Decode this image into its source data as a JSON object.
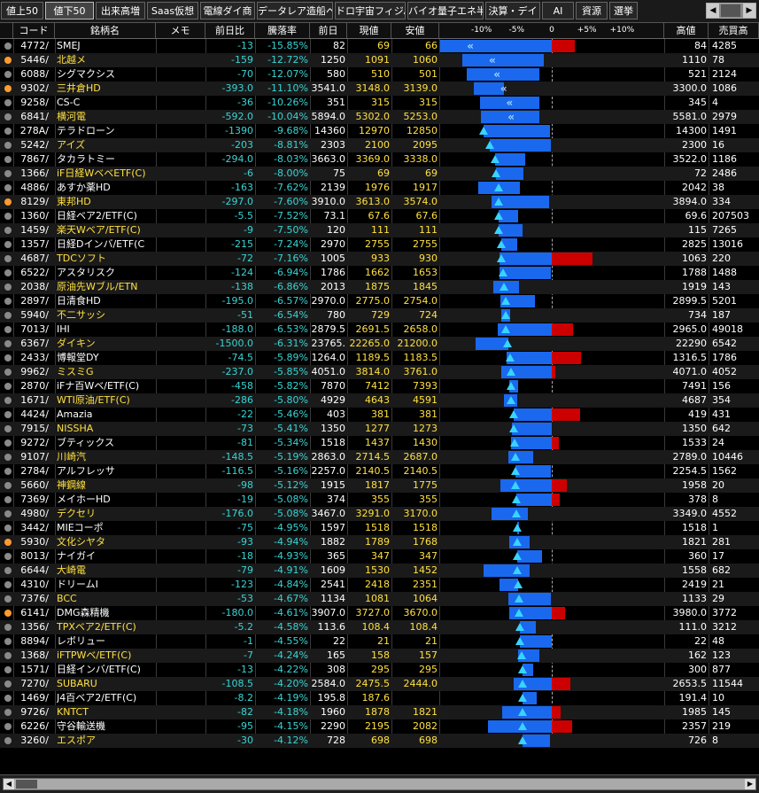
{
  "tabs": [
    {
      "label": "値上50",
      "active": false
    },
    {
      "label": "値下50",
      "active": true
    },
    {
      "label": "出来高増",
      "active": false
    },
    {
      "label": "Saas仮想",
      "active": false
    },
    {
      "label": "電線ダイ商",
      "active": false
    },
    {
      "label": "データレア造船ペロ銀行",
      "active": false
    },
    {
      "label": "ドロ宇宙フィジAI",
      "active": false
    },
    {
      "label": "バイオ量子エネ半導",
      "active": false
    },
    {
      "label": "決算・デイ",
      "active": false
    },
    {
      "label": "AI",
      "active": false
    },
    {
      "label": "資源",
      "active": false
    },
    {
      "label": "選挙",
      "active": false
    }
  ],
  "columns": {
    "code": "コード",
    "name": "銘柄名",
    "memo": "メモ",
    "change": "前日比",
    "drop_rate": "騰落率",
    "prev": "前日",
    "current": "現値",
    "low": "安値",
    "high": "高値",
    "volume": "売買高"
  },
  "axis": {
    "labels": [
      "-10%",
      "-5%",
      "0",
      "+5%",
      "+10%"
    ],
    "ticks": [
      -10,
      -5,
      0,
      5,
      10
    ],
    "range": [
      -16,
      16
    ]
  },
  "colors": {
    "change_neg": "#38d4d4",
    "price": "#ffe040",
    "bar_neg": "#1a68ee",
    "bar_pos": "#cc0000",
    "marker": "#38d4ff"
  },
  "rows": [
    {
      "dot": "grey",
      "code": "4772/",
      "name": "SMEJ",
      "yellow": false,
      "memo": "",
      "change": "-13",
      "pct": "-15.85%",
      "prev": "82",
      "now": "69",
      "low": "66",
      "high": "84",
      "vol": "4285",
      "bar_from": -15.85,
      "bar_to": 3.3,
      "marker": -15.85
    },
    {
      "dot": "orange",
      "code": "5446/",
      "name": "北越メ",
      "yellow": true,
      "memo": "",
      "change": "-159",
      "pct": "-12.72%",
      "prev": "1250",
      "now": "1091",
      "low": "1060",
      "high": "1110",
      "vol": "78",
      "bar_from": -12.72,
      "bar_to": -1.1,
      "marker": -12.72
    },
    {
      "dot": "grey",
      "code": "6088/",
      "name": "シグマクシス",
      "yellow": false,
      "memo": "",
      "change": "-70",
      "pct": "-12.07%",
      "prev": "580",
      "now": "510",
      "low": "501",
      "high": "521",
      "vol": "2124",
      "bar_from": -12.07,
      "bar_to": -1.7,
      "marker": -12.07
    },
    {
      "dot": "orange",
      "code": "9302/",
      "name": "三井倉HD",
      "yellow": true,
      "memo": "",
      "change": "-393.0",
      "pct": "-11.10%",
      "prev": "3541.0",
      "now": "3148.0",
      "low": "3139.0",
      "high": "3300.0",
      "vol": "1086",
      "bar_from": -11.1,
      "bar_to": -6.8,
      "marker": -11.1
    },
    {
      "dot": "grey",
      "code": "9258/",
      "name": "CS-C",
      "yellow": false,
      "memo": "",
      "change": "-36",
      "pct": "-10.26%",
      "prev": "351",
      "now": "315",
      "low": "315",
      "high": "345",
      "vol": "4",
      "bar_from": -10.26,
      "bar_to": -1.7,
      "marker": -10.26
    },
    {
      "dot": "grey",
      "code": "6841/",
      "name": "横河電",
      "yellow": true,
      "memo": "",
      "change": "-592.0",
      "pct": "-10.04%",
      "prev": "5894.0",
      "now": "5302.0",
      "low": "5253.0",
      "high": "5581.0",
      "vol": "2979",
      "bar_from": -10.04,
      "bar_to": -1.7,
      "marker": -10.04
    },
    {
      "dot": "grey",
      "code": "278A/",
      "name": "テラドローン",
      "yellow": false,
      "memo": "",
      "change": "-1390",
      "pct": "-9.68%",
      "prev": "14360",
      "now": "12970",
      "low": "12850",
      "high": "14300",
      "vol": "1491",
      "bar_from": -9.68,
      "bar_to": -0.3,
      "marker": -9.68
    },
    {
      "dot": "grey",
      "code": "5242/",
      "name": "アイズ",
      "yellow": true,
      "memo": "",
      "change": "-203",
      "pct": "-8.81%",
      "prev": "2303",
      "now": "2100",
      "low": "2095",
      "high": "2300",
      "vol": "16",
      "bar_from": -8.81,
      "bar_to": -0.1,
      "marker": -8.81
    },
    {
      "dot": "grey",
      "code": "7867/",
      "name": "タカラトミー",
      "yellow": false,
      "memo": "",
      "change": "-294.0",
      "pct": "-8.03%",
      "prev": "3663.0",
      "now": "3369.0",
      "low": "3338.0",
      "high": "3522.0",
      "vol": "1186",
      "bar_from": -8.03,
      "bar_to": -3.8,
      "marker": -8.03
    },
    {
      "dot": "grey",
      "code": "1366/",
      "name": "iF日経WベベETF(C)",
      "yellow": true,
      "memo": "",
      "change": "-6",
      "pct": "-8.00%",
      "prev": "75",
      "now": "69",
      "low": "69",
      "high": "72",
      "vol": "2486",
      "bar_from": -8.0,
      "bar_to": -4.0,
      "marker": -8.0
    },
    {
      "dot": "grey",
      "code": "4886/",
      "name": "あすか薬HD",
      "yellow": false,
      "memo": "",
      "change": "-163",
      "pct": "-7.62%",
      "prev": "2139",
      "now": "1976",
      "low": "1917",
      "high": "2042",
      "vol": "38",
      "bar_from": -10.4,
      "bar_to": -4.5,
      "marker": -7.62
    },
    {
      "dot": "orange",
      "code": "8129/",
      "name": "東邦HD",
      "yellow": true,
      "memo": "",
      "change": "-297.0",
      "pct": "-7.60%",
      "prev": "3910.0",
      "now": "3613.0",
      "low": "3574.0",
      "high": "3894.0",
      "vol": "334",
      "bar_from": -8.6,
      "bar_to": -0.4,
      "marker": -7.6
    },
    {
      "dot": "grey",
      "code": "1360/",
      "name": "日経ベア2/ETF(C)",
      "yellow": false,
      "memo": "",
      "change": "-5.5",
      "pct": "-7.52%",
      "prev": "73.1",
      "now": "67.6",
      "low": "67.6",
      "high": "69.6",
      "vol": "207503",
      "bar_from": -7.52,
      "bar_to": -4.8,
      "marker": -7.52
    },
    {
      "dot": "grey",
      "code": "1459/",
      "name": "楽天Wベア/ETF(C)",
      "yellow": true,
      "memo": "",
      "change": "-9",
      "pct": "-7.50%",
      "prev": "120",
      "now": "111",
      "low": "111",
      "high": "115",
      "vol": "7265",
      "bar_from": -7.5,
      "bar_to": -4.2,
      "marker": -7.5
    },
    {
      "dot": "grey",
      "code": "1357/",
      "name": "日経Dインバ/ETF(C",
      "yellow": false,
      "memo": "",
      "change": "-215",
      "pct": "-7.24%",
      "prev": "2970",
      "now": "2755",
      "low": "2755",
      "high": "2825",
      "vol": "13016",
      "bar_from": -7.24,
      "bar_to": -4.9,
      "marker": -7.24
    },
    {
      "dot": "grey",
      "code": "4687/",
      "name": "TDCソフト",
      "yellow": true,
      "memo": "",
      "change": "-72",
      "pct": "-7.16%",
      "prev": "1005",
      "now": "933",
      "low": "930",
      "high": "1063",
      "vol": "220",
      "bar_from": -7.46,
      "bar_to": 5.8,
      "marker": -7.16
    },
    {
      "dot": "grey",
      "code": "6522/",
      "name": "アスタリスク",
      "yellow": false,
      "memo": "",
      "change": "-124",
      "pct": "-6.94%",
      "prev": "1786",
      "now": "1662",
      "low": "1653",
      "high": "1788",
      "vol": "1488",
      "bar_from": -7.45,
      "bar_to": -0.1,
      "marker": -6.94
    },
    {
      "dot": "grey",
      "code": "2038/",
      "name": "原油先Wブル/ETN",
      "yellow": true,
      "memo": "",
      "change": "-138",
      "pct": "-6.86%",
      "prev": "2013",
      "now": "1875",
      "low": "1845",
      "high": "1919",
      "vol": "143",
      "bar_from": -8.3,
      "bar_to": -4.6,
      "marker": -6.86
    },
    {
      "dot": "grey",
      "code": "2897/",
      "name": "日清食HD",
      "yellow": false,
      "memo": "",
      "change": "-195.0",
      "pct": "-6.57%",
      "prev": "2970.0",
      "now": "2775.0",
      "low": "2754.0",
      "high": "2899.5",
      "vol": "5201",
      "bar_from": -7.27,
      "bar_to": -2.4,
      "marker": -6.57
    },
    {
      "dot": "grey",
      "code": "5940/",
      "name": "不二サッシ",
      "yellow": true,
      "memo": "",
      "change": "-51",
      "pct": "-6.54%",
      "prev": "780",
      "now": "729",
      "low": "724",
      "high": "734",
      "vol": "187",
      "bar_from": -7.18,
      "bar_to": -5.9,
      "marker": -6.54
    },
    {
      "dot": "grey",
      "code": "7013/",
      "name": "IHI",
      "yellow": false,
      "memo": "",
      "change": "-188.0",
      "pct": "-6.53%",
      "prev": "2879.5",
      "now": "2691.5",
      "low": "2658.0",
      "high": "2965.0",
      "vol": "49018",
      "bar_from": -7.7,
      "bar_to": 3.0,
      "marker": -6.53
    },
    {
      "dot": "grey",
      "code": "6367/",
      "name": "ダイキン",
      "yellow": true,
      "memo": "",
      "change": "-1500.0",
      "pct": "-6.31%",
      "prev": "23765.",
      "now": "22265.0",
      "low": "21200.0",
      "high": "22290",
      "vol": "6542",
      "bar_from": -10.8,
      "bar_to": -6.2,
      "marker": -6.31
    },
    {
      "dot": "grey",
      "code": "2433/",
      "name": "博報堂DY",
      "yellow": false,
      "memo": "",
      "change": "-74.5",
      "pct": "-5.89%",
      "prev": "1264.0",
      "now": "1189.5",
      "low": "1183.5",
      "high": "1316.5",
      "vol": "1786",
      "bar_from": -6.4,
      "bar_to": 4.2,
      "marker": -5.89
    },
    {
      "dot": "grey",
      "code": "9962/",
      "name": "ミスミG",
      "yellow": true,
      "memo": "",
      "change": "-237.0",
      "pct": "-5.85%",
      "prev": "4051.0",
      "now": "3814.0",
      "low": "3761.0",
      "high": "4071.0",
      "vol": "4052",
      "bar_from": -7.2,
      "bar_to": 0.5,
      "marker": -5.85
    },
    {
      "dot": "grey",
      "code": "2870/",
      "name": "iFナ百Wベ/ETF(C)",
      "yellow": false,
      "memo": "",
      "change": "-458",
      "pct": "-5.82%",
      "prev": "7870",
      "now": "7412",
      "low": "7393",
      "high": "7491",
      "vol": "156",
      "bar_from": -6.06,
      "bar_to": -4.8,
      "marker": -5.82
    },
    {
      "dot": "grey",
      "code": "1671/",
      "name": "WTI原油/ETF(C)",
      "yellow": true,
      "memo": "",
      "change": "-286",
      "pct": "-5.80%",
      "prev": "4929",
      "now": "4643",
      "low": "4591",
      "high": "4687",
      "vol": "354",
      "bar_from": -6.86,
      "bar_to": -4.9,
      "marker": -5.8
    },
    {
      "dot": "grey",
      "code": "4424/",
      "name": "Amazia",
      "yellow": false,
      "memo": "",
      "change": "-22",
      "pct": "-5.46%",
      "prev": "403",
      "now": "381",
      "low": "381",
      "high": "419",
      "vol": "431",
      "bar_from": -5.46,
      "bar_to": 4.0,
      "marker": -5.46
    },
    {
      "dot": "grey",
      "code": "7915/",
      "name": "NISSHA",
      "yellow": true,
      "memo": "",
      "change": "-73",
      "pct": "-5.41%",
      "prev": "1350",
      "now": "1277",
      "low": "1273",
      "high": "1350",
      "vol": "642",
      "bar_from": -5.7,
      "bar_to": 0.0,
      "marker": -5.41
    },
    {
      "dot": "grey",
      "code": "9272/",
      "name": "ブティックス",
      "yellow": false,
      "memo": "",
      "change": "-81",
      "pct": "-5.34%",
      "prev": "1518",
      "now": "1437",
      "low": "1430",
      "high": "1533",
      "vol": "24",
      "bar_from": -5.8,
      "bar_to": 1.0,
      "marker": -5.34
    },
    {
      "dot": "grey",
      "code": "9107/",
      "name": "川崎汽",
      "yellow": true,
      "memo": "",
      "change": "-148.5",
      "pct": "-5.19%",
      "prev": "2863.0",
      "now": "2714.5",
      "low": "2687.0",
      "high": "2789.0",
      "vol": "10446",
      "bar_from": -6.15,
      "bar_to": -2.6,
      "marker": -5.19
    },
    {
      "dot": "grey",
      "code": "2784/",
      "name": "アルフレッサ",
      "yellow": false,
      "memo": "",
      "change": "-116.5",
      "pct": "-5.16%",
      "prev": "2257.0",
      "now": "2140.5",
      "low": "2140.5",
      "high": "2254.5",
      "vol": "1562",
      "bar_from": -5.16,
      "bar_to": -0.1,
      "marker": -5.16
    },
    {
      "dot": "grey",
      "code": "5660/",
      "name": "神鋼線",
      "yellow": true,
      "memo": "",
      "change": "-98",
      "pct": "-5.12%",
      "prev": "1915",
      "now": "1817",
      "low": "1775",
      "high": "1958",
      "vol": "20",
      "bar_from": -7.3,
      "bar_to": 2.2,
      "marker": -5.12
    },
    {
      "dot": "grey",
      "code": "7369/",
      "name": "メイホーHD",
      "yellow": false,
      "memo": "",
      "change": "-19",
      "pct": "-5.08%",
      "prev": "374",
      "now": "355",
      "low": "355",
      "high": "378",
      "vol": "8",
      "bar_from": -5.08,
      "bar_to": 1.1,
      "marker": -5.08
    },
    {
      "dot": "grey",
      "code": "4980/",
      "name": "デクセリ",
      "yellow": true,
      "memo": "",
      "change": "-176.0",
      "pct": "-5.08%",
      "prev": "3467.0",
      "now": "3291.0",
      "low": "3170.0",
      "high": "3349.0",
      "vol": "4552",
      "bar_from": -8.6,
      "bar_to": -3.4,
      "marker": -5.08
    },
    {
      "dot": "grey",
      "code": "3442/",
      "name": "MIEコーポ",
      "yellow": false,
      "memo": "",
      "change": "-75",
      "pct": "-4.95%",
      "prev": "1597",
      "now": "1518",
      "low": "1518",
      "high": "1518",
      "vol": "1",
      "bar_from": -4.95,
      "bar_to": -4.95,
      "marker": -4.95
    },
    {
      "dot": "orange",
      "code": "5930/",
      "name": "文化シヤタ",
      "yellow": true,
      "memo": "",
      "change": "-93",
      "pct": "-4.94%",
      "prev": "1882",
      "now": "1789",
      "low": "1768",
      "high": "1821",
      "vol": "281",
      "bar_from": -6.05,
      "bar_to": -3.2,
      "marker": -4.94
    },
    {
      "dot": "grey",
      "code": "8013/",
      "name": "ナイガイ",
      "yellow": false,
      "memo": "",
      "change": "-18",
      "pct": "-4.93%",
      "prev": "365",
      "now": "347",
      "low": "347",
      "high": "360",
      "vol": "17",
      "bar_from": -4.93,
      "bar_to": -1.4,
      "marker": -4.93
    },
    {
      "dot": "grey",
      "code": "6644/",
      "name": "大崎電",
      "yellow": true,
      "memo": "",
      "change": "-79",
      "pct": "-4.91%",
      "prev": "1609",
      "now": "1530",
      "low": "1452",
      "high": "1558",
      "vol": "682",
      "bar_from": -9.76,
      "bar_to": -3.2,
      "marker": -4.91
    },
    {
      "dot": "grey",
      "code": "4310/",
      "name": "ドリームI",
      "yellow": false,
      "memo": "",
      "change": "-123",
      "pct": "-4.84%",
      "prev": "2541",
      "now": "2418",
      "low": "2351",
      "high": "2419",
      "vol": "21",
      "bar_from": -7.48,
      "bar_to": -4.8,
      "marker": -4.84
    },
    {
      "dot": "grey",
      "code": "7376/",
      "name": "BCC",
      "yellow": true,
      "memo": "",
      "change": "-53",
      "pct": "-4.67%",
      "prev": "1134",
      "now": "1081",
      "low": "1064",
      "high": "1133",
      "vol": "29",
      "bar_from": -6.17,
      "bar_to": -0.1,
      "marker": -4.67
    },
    {
      "dot": "orange",
      "code": "6141/",
      "name": "DMG森精機",
      "yellow": false,
      "memo": "",
      "change": "-180.0",
      "pct": "-4.61%",
      "prev": "3907.0",
      "now": "3727.0",
      "low": "3670.0",
      "high": "3980.0",
      "vol": "3772",
      "bar_from": -6.07,
      "bar_to": 1.9,
      "marker": -4.61
    },
    {
      "dot": "grey",
      "code": "1356/",
      "name": "TPXベア2/ETF(C)",
      "yellow": true,
      "memo": "",
      "change": "-5.2",
      "pct": "-4.58%",
      "prev": "113.6",
      "now": "108.4",
      "low": "108.4",
      "high": "111.0",
      "vol": "3212",
      "bar_from": -4.58,
      "bar_to": -2.3,
      "marker": -4.58
    },
    {
      "dot": "grey",
      "code": "8894/",
      "name": "レボリュー",
      "yellow": false,
      "memo": "",
      "change": "-1",
      "pct": "-4.55%",
      "prev": "22",
      "now": "21",
      "low": "21",
      "high": "22",
      "vol": "48",
      "bar_from": -4.55,
      "bar_to": 0.0,
      "marker": -4.55
    },
    {
      "dot": "grey",
      "code": "1368/",
      "name": "iFTPWベ/ETF(C)",
      "yellow": true,
      "memo": "",
      "change": "-7",
      "pct": "-4.24%",
      "prev": "165",
      "now": "158",
      "low": "157",
      "high": "162",
      "vol": "123",
      "bar_from": -4.85,
      "bar_to": -1.8,
      "marker": -4.24
    },
    {
      "dot": "grey",
      "code": "1571/",
      "name": "日経インバ/ETF(C)",
      "yellow": false,
      "memo": "",
      "change": "-13",
      "pct": "-4.22%",
      "prev": "308",
      "now": "295",
      "low": "295",
      "high": "300",
      "vol": "877",
      "bar_from": -4.22,
      "bar_to": -2.6,
      "marker": -4.22
    },
    {
      "dot": "grey",
      "code": "7270/",
      "name": "SUBARU",
      "yellow": true,
      "memo": "",
      "change": "-108.5",
      "pct": "-4.20%",
      "prev": "2584.0",
      "now": "2475.5",
      "low": "2444.0",
      "high": "2653.5",
      "vol": "11544",
      "bar_from": -5.42,
      "bar_to": 2.7,
      "marker": -4.2
    },
    {
      "dot": "grey",
      "code": "1469/",
      "name": "J4百ベア2/ETF(C)",
      "yellow": false,
      "memo": "",
      "change": "-8.2",
      "pct": "-4.19%",
      "prev": "195.8",
      "now": "187.6",
      "low": "",
      "high": "191.4",
      "vol": "10",
      "bar_from": -4.19,
      "bar_to": -2.2,
      "marker": -4.19
    },
    {
      "dot": "grey",
      "code": "9726/",
      "name": "KNTCT",
      "yellow": true,
      "memo": "",
      "change": "-82",
      "pct": "-4.18%",
      "prev": "1960",
      "now": "1878",
      "low": "1821",
      "high": "1985",
      "vol": "145",
      "bar_from": -7.09,
      "bar_to": 1.3,
      "marker": -4.18
    },
    {
      "dot": "grey",
      "code": "6226/",
      "name": "守谷輸送機",
      "yellow": false,
      "memo": "",
      "change": "-95",
      "pct": "-4.15%",
      "prev": "2290",
      "now": "2195",
      "low": "2082",
      "high": "2357",
      "vol": "219",
      "bar_from": -9.08,
      "bar_to": 2.9,
      "marker": -4.15
    },
    {
      "dot": "grey",
      "code": "3260/",
      "name": "エスポア",
      "yellow": true,
      "memo": "",
      "change": "-30",
      "pct": "-4.12%",
      "prev": "728",
      "now": "698",
      "low": "698",
      "high": "726",
      "vol": "8",
      "bar_from": -4.12,
      "bar_to": -0.3,
      "marker": -4.12
    }
  ]
}
